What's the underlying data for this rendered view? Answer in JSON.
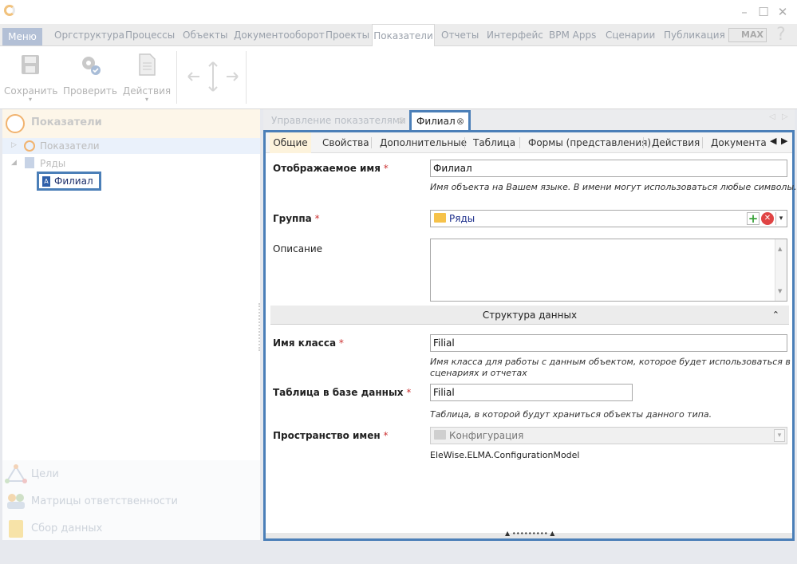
{
  "menu": {
    "label": "Меню",
    "tabs": [
      "Оргструктура",
      "Процессы",
      "Объекты",
      "Документооборот",
      "Проекты",
      "Показатели",
      "Отчеты",
      "Интерфейс",
      "BPM Apps",
      "Сценарии",
      "Публикация"
    ],
    "active_tab": "Показатели",
    "edition": "MAX"
  },
  "ribbon": {
    "save": "Сохранить",
    "check": "Проверить",
    "actions": "Действия"
  },
  "left_panel": {
    "title": "Показатели",
    "tree": {
      "node1": "Показатели",
      "node2": "Ряды",
      "selected": "Филиал"
    },
    "bottom": {
      "goals": "Цели",
      "matrices": "Матрицы ответственности",
      "data": "Сбор данных"
    }
  },
  "doc_tabs": {
    "inactive": "Управление показателями",
    "active": "Филиал"
  },
  "form_tabs": {
    "general": "Общие",
    "properties": "Свойства",
    "additional": "Дополнительные",
    "table": "Таблица",
    "forms": "Формы (представления)",
    "actions": "Действия",
    "docs": "Документац"
  },
  "form": {
    "display_name": {
      "label": "Отображаемое имя",
      "value": "Филиал",
      "hint": "Имя объекта на Вашем языке. В имени могут использоваться любые символы."
    },
    "group": {
      "label": "Группа",
      "value": "Ряды"
    },
    "description": {
      "label": "Описание"
    },
    "section": "Структура данных",
    "class_name": {
      "label": "Имя класса",
      "value": "Filial",
      "hint1": "Имя класса для работы с данным объектом, которое будет использоваться в",
      "hint2": "сценариях и отчетах"
    },
    "db_table": {
      "label": "Таблица в базе данных",
      "value": "Filial",
      "hint": "Таблица, в которой будут храниться объекты данного типа."
    },
    "namespace": {
      "label": "Пространство имен",
      "value": "Конфигурация",
      "full": "EleWise.ELMA.ConfigurationModel"
    },
    "required_mark": "*"
  },
  "colors": {
    "accent": "#4b7fb8",
    "required": "#cc3333"
  }
}
